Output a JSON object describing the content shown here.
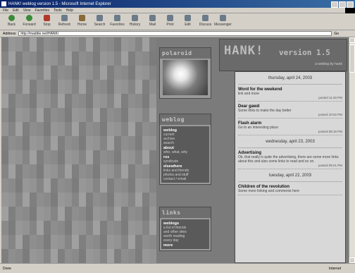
{
  "window": {
    "title": "HANK! weblog version 1.5 - Microsoft Internet Explorer"
  },
  "menu": [
    "File",
    "Edit",
    "View",
    "Favorites",
    "Tools",
    "Help"
  ],
  "toolbar": [
    {
      "label": "Back",
      "icon": "back-icon"
    },
    {
      "label": "Forward",
      "icon": "forward-icon"
    },
    {
      "label": "Stop",
      "icon": "stop-icon"
    },
    {
      "label": "Refresh",
      "icon": "refresh-icon"
    },
    {
      "label": "Home",
      "icon": "home-icon"
    },
    {
      "label": "Search",
      "icon": "search-icon"
    },
    {
      "label": "Favorites",
      "icon": "favorites-icon"
    },
    {
      "label": "History",
      "icon": "history-icon"
    },
    {
      "label": "Mail",
      "icon": "mail-icon"
    },
    {
      "label": "Print",
      "icon": "print-icon"
    },
    {
      "label": "Edit",
      "icon": "edit-icon"
    },
    {
      "label": "Discuss",
      "icon": "discuss-icon"
    },
    {
      "label": "Messenger",
      "icon": "messenger-icon"
    }
  ],
  "address": {
    "label": "Address",
    "value": "http://maddie.net/HANK/",
    "go": "Go"
  },
  "sidebar": {
    "polaroid_title": "polaroid",
    "weblog_title": "weblog",
    "weblog_lines": [
      {
        "text": "weblog",
        "head": true
      },
      {
        "text": "current",
        "head": false
      },
      {
        "text": "archive",
        "head": false
      },
      {
        "text": "search",
        "head": false
      },
      {
        "text": "about",
        "head": true
      },
      {
        "text": "who, what, why",
        "head": false
      },
      {
        "text": "rss",
        "head": true
      },
      {
        "text": "syndicate",
        "head": false
      },
      {
        "text": "elsewhere",
        "head": true
      },
      {
        "text": "links and friends",
        "head": false
      },
      {
        "text": "photos and stuff",
        "head": false
      },
      {
        "text": "contact / email",
        "head": false
      }
    ],
    "links_title": "links",
    "links_lines": [
      {
        "text": "weblogs",
        "head": true
      },
      {
        "text": "a list of friends",
        "head": false
      },
      {
        "text": "and other sites",
        "head": false
      },
      {
        "text": "worth reading",
        "head": false
      },
      {
        "text": "every day",
        "head": false
      },
      {
        "text": "more",
        "head": true
      }
    ]
  },
  "banner": {
    "title": "HANK!",
    "version": "version 1.5",
    "subtitle": "a weblog by hank"
  },
  "posts": [
    {
      "date": "thursday, april 24, 2003",
      "items": [
        {
          "title": "Word for the weekend",
          "body": "link and more",
          "footer": "posted 11:40 PM"
        },
        {
          "title": "Dear gawd",
          "body": "Some links to make the day better",
          "footer": "posted 10:02 PM"
        },
        {
          "title": "Flash alarm",
          "body": "Go to an interesting place",
          "footer": "posted 08:15 PM"
        }
      ]
    },
    {
      "date": "wednesday, april 23, 2003",
      "items": [
        {
          "title": "Advertising",
          "body": "Ok, that really is quite the advertising, there are some more links about this and also some links to read and so on.",
          "footer": "posted 09:21 PM"
        }
      ]
    },
    {
      "date": "tuesday, april 22, 2003",
      "items": [
        {
          "title": "Children of the revolution",
          "body": "Some more linking and comments here",
          "footer": ""
        }
      ]
    }
  ],
  "status": {
    "left": "Done",
    "zone": "Internet"
  }
}
